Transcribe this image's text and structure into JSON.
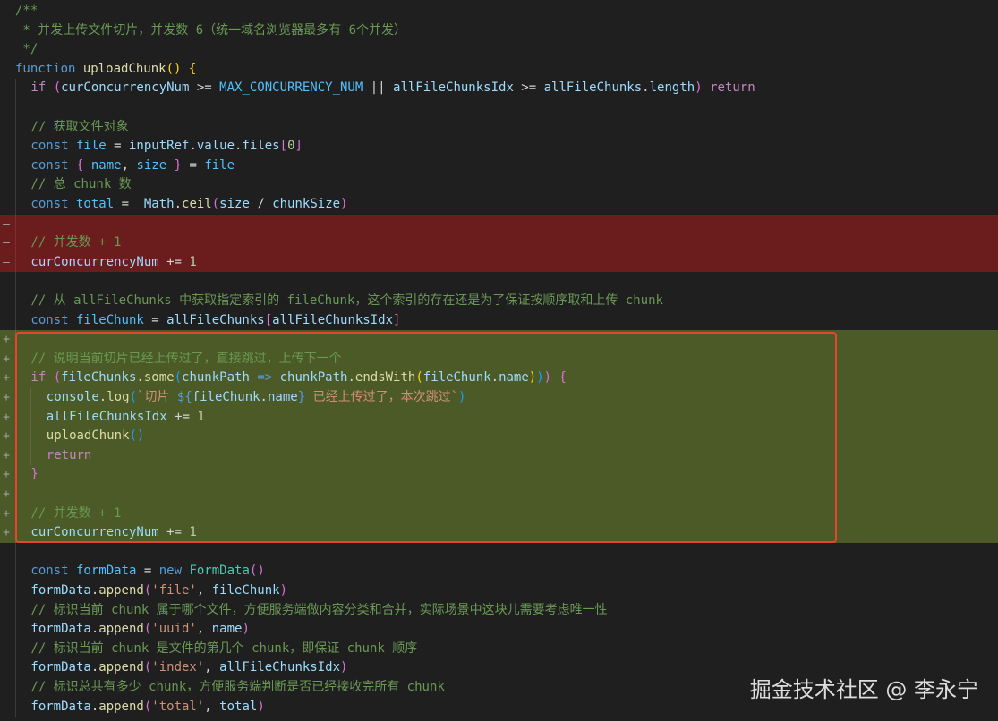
{
  "editor": {
    "language": "javascript",
    "lines": [
      {
        "diff": "",
        "indent": 0,
        "tokens": [
          {
            "t": "/**",
            "c": "cm"
          }
        ]
      },
      {
        "diff": "",
        "indent": 0,
        "tokens": [
          {
            "t": " * 并发上传文件切片，并发数 6（统一域名浏览器最多有 6个并发）",
            "c": "cm"
          }
        ]
      },
      {
        "diff": "",
        "indent": 0,
        "tokens": [
          {
            "t": " */",
            "c": "cm"
          }
        ]
      },
      {
        "diff": "",
        "indent": 0,
        "tokens": [
          {
            "t": "function",
            "c": "st"
          },
          {
            "t": " ",
            "c": "op"
          },
          {
            "t": "uploadChunk",
            "c": "fn"
          },
          {
            "t": "()",
            "c": "b1"
          },
          {
            "t": " ",
            "c": "op"
          },
          {
            "t": "{",
            "c": "b1"
          }
        ]
      },
      {
        "diff": "",
        "indent": 1,
        "tokens": [
          {
            "t": "if",
            "c": "kw"
          },
          {
            "t": " ",
            "c": "op"
          },
          {
            "t": "(",
            "c": "b2"
          },
          {
            "t": "curConcurrencyNum",
            "c": "vr"
          },
          {
            "t": " >= ",
            "c": "op"
          },
          {
            "t": "MAX_CONCURRENCY_NUM",
            "c": "cn"
          },
          {
            "t": " || ",
            "c": "op"
          },
          {
            "t": "allFileChunksIdx",
            "c": "vr"
          },
          {
            "t": " >= ",
            "c": "op"
          },
          {
            "t": "allFileChunks",
            "c": "vr"
          },
          {
            "t": ".",
            "c": "op"
          },
          {
            "t": "length",
            "c": "vr"
          },
          {
            "t": ")",
            "c": "b2"
          },
          {
            "t": " ",
            "c": "op"
          },
          {
            "t": "return",
            "c": "kw"
          }
        ]
      },
      {
        "diff": "",
        "indent": 1,
        "tokens": []
      },
      {
        "diff": "",
        "indent": 1,
        "tokens": [
          {
            "t": "// 获取文件对象",
            "c": "cm"
          }
        ]
      },
      {
        "diff": "",
        "indent": 1,
        "tokens": [
          {
            "t": "const",
            "c": "st"
          },
          {
            "t": " ",
            "c": "op"
          },
          {
            "t": "file",
            "c": "cn"
          },
          {
            "t": " = ",
            "c": "op"
          },
          {
            "t": "inputRef",
            "c": "vr"
          },
          {
            "t": ".",
            "c": "op"
          },
          {
            "t": "value",
            "c": "vr"
          },
          {
            "t": ".",
            "c": "op"
          },
          {
            "t": "files",
            "c": "vr"
          },
          {
            "t": "[",
            "c": "b2"
          },
          {
            "t": "0",
            "c": "nm"
          },
          {
            "t": "]",
            "c": "b2"
          }
        ]
      },
      {
        "diff": "",
        "indent": 1,
        "tokens": [
          {
            "t": "const",
            "c": "st"
          },
          {
            "t": " ",
            "c": "op"
          },
          {
            "t": "{",
            "c": "b2"
          },
          {
            "t": " ",
            "c": "op"
          },
          {
            "t": "name",
            "c": "cn"
          },
          {
            "t": ", ",
            "c": "op"
          },
          {
            "t": "size",
            "c": "cn"
          },
          {
            "t": " ",
            "c": "op"
          },
          {
            "t": "}",
            "c": "b2"
          },
          {
            "t": " = ",
            "c": "op"
          },
          {
            "t": "file",
            "c": "cn"
          }
        ]
      },
      {
        "diff": "",
        "indent": 1,
        "tokens": [
          {
            "t": "// 总 chunk 数",
            "c": "cm"
          }
        ]
      },
      {
        "diff": "",
        "indent": 1,
        "tokens": [
          {
            "t": "const",
            "c": "st"
          },
          {
            "t": " ",
            "c": "op"
          },
          {
            "t": "total",
            "c": "cn"
          },
          {
            "t": " =  ",
            "c": "op"
          },
          {
            "t": "Math",
            "c": "vr"
          },
          {
            "t": ".",
            "c": "op"
          },
          {
            "t": "ceil",
            "c": "fn"
          },
          {
            "t": "(",
            "c": "b2"
          },
          {
            "t": "size",
            "c": "vr"
          },
          {
            "t": " / ",
            "c": "op"
          },
          {
            "t": "chunkSize",
            "c": "vr"
          },
          {
            "t": ")",
            "c": "b2"
          }
        ]
      },
      {
        "diff": "-",
        "indent": 1,
        "tokens": []
      },
      {
        "diff": "-",
        "indent": 1,
        "tokens": [
          {
            "t": "// 并发数 + 1",
            "c": "cm"
          }
        ]
      },
      {
        "diff": "-",
        "indent": 1,
        "tokens": [
          {
            "t": "curConcurrencyNum",
            "c": "vr"
          },
          {
            "t": " += ",
            "c": "op"
          },
          {
            "t": "1",
            "c": "nm"
          }
        ]
      },
      {
        "diff": "",
        "indent": 1,
        "tokens": []
      },
      {
        "diff": "",
        "indent": 1,
        "tokens": [
          {
            "t": "// 从 allFileChunks 中获取指定索引的 fileChunk，这个索引的存在还是为了保证按顺序取和上传 chunk",
            "c": "cm"
          }
        ]
      },
      {
        "diff": "",
        "indent": 1,
        "tokens": [
          {
            "t": "const",
            "c": "st"
          },
          {
            "t": " ",
            "c": "op"
          },
          {
            "t": "fileChunk",
            "c": "cn"
          },
          {
            "t": " = ",
            "c": "op"
          },
          {
            "t": "allFileChunks",
            "c": "vr"
          },
          {
            "t": "[",
            "c": "b2"
          },
          {
            "t": "allFileChunksIdx",
            "c": "vr"
          },
          {
            "t": "]",
            "c": "b2"
          }
        ]
      },
      {
        "diff": "+",
        "indent": 1,
        "tokens": []
      },
      {
        "diff": "+",
        "indent": 1,
        "tokens": [
          {
            "t": "// 说明当前切片已经上传过了，直接跳过，上传下一个",
            "c": "cm"
          }
        ]
      },
      {
        "diff": "+",
        "indent": 1,
        "tokens": [
          {
            "t": "if",
            "c": "kw"
          },
          {
            "t": " ",
            "c": "op"
          },
          {
            "t": "(",
            "c": "b2"
          },
          {
            "t": "fileChunks",
            "c": "vr"
          },
          {
            "t": ".",
            "c": "op"
          },
          {
            "t": "some",
            "c": "fn"
          },
          {
            "t": "(",
            "c": "b3"
          },
          {
            "t": "chunkPath",
            "c": "vr"
          },
          {
            "t": " ",
            "c": "op"
          },
          {
            "t": "=>",
            "c": "st"
          },
          {
            "t": " ",
            "c": "op"
          },
          {
            "t": "chunkPath",
            "c": "vr"
          },
          {
            "t": ".",
            "c": "op"
          },
          {
            "t": "endsWith",
            "c": "fn"
          },
          {
            "t": "(",
            "c": "b1"
          },
          {
            "t": "fileChunk",
            "c": "vr"
          },
          {
            "t": ".",
            "c": "op"
          },
          {
            "t": "name",
            "c": "vr"
          },
          {
            "t": ")",
            "c": "b1"
          },
          {
            "t": ")",
            "c": "b3"
          },
          {
            "t": ")",
            "c": "b2"
          },
          {
            "t": " ",
            "c": "op"
          },
          {
            "t": "{",
            "c": "b2"
          }
        ]
      },
      {
        "diff": "+",
        "indent": 2,
        "tokens": [
          {
            "t": "console",
            "c": "vr"
          },
          {
            "t": ".",
            "c": "op"
          },
          {
            "t": "log",
            "c": "fn"
          },
          {
            "t": "(",
            "c": "b3"
          },
          {
            "t": "`切片 ",
            "c": "s"
          },
          {
            "t": "${",
            "c": "st"
          },
          {
            "t": "fileChunk",
            "c": "vr"
          },
          {
            "t": ".",
            "c": "op"
          },
          {
            "t": "name",
            "c": "vr"
          },
          {
            "t": "}",
            "c": "st"
          },
          {
            "t": " 已经上传过了，本次跳过`",
            "c": "s"
          },
          {
            "t": ")",
            "c": "b3"
          }
        ]
      },
      {
        "diff": "+",
        "indent": 2,
        "tokens": [
          {
            "t": "allFileChunksIdx",
            "c": "vr"
          },
          {
            "t": " += ",
            "c": "op"
          },
          {
            "t": "1",
            "c": "nm"
          }
        ]
      },
      {
        "diff": "+",
        "indent": 2,
        "tokens": [
          {
            "t": "uploadChunk",
            "c": "fn"
          },
          {
            "t": "()",
            "c": "b3"
          }
        ]
      },
      {
        "diff": "+",
        "indent": 2,
        "tokens": [
          {
            "t": "return",
            "c": "kw"
          }
        ]
      },
      {
        "diff": "+",
        "indent": 1,
        "tokens": [
          {
            "t": "}",
            "c": "b2"
          }
        ]
      },
      {
        "diff": "+",
        "indent": 1,
        "tokens": []
      },
      {
        "diff": "+",
        "indent": 1,
        "tokens": [
          {
            "t": "// 并发数 + 1",
            "c": "cm"
          }
        ]
      },
      {
        "diff": "+",
        "indent": 1,
        "tokens": [
          {
            "t": "curConcurrencyNum",
            "c": "vr"
          },
          {
            "t": " += ",
            "c": "op"
          },
          {
            "t": "1",
            "c": "nm"
          }
        ]
      },
      {
        "diff": "",
        "indent": 1,
        "tokens": []
      },
      {
        "diff": "",
        "indent": 1,
        "tokens": [
          {
            "t": "const",
            "c": "st"
          },
          {
            "t": " ",
            "c": "op"
          },
          {
            "t": "formData",
            "c": "cn"
          },
          {
            "t": " = ",
            "c": "op"
          },
          {
            "t": "new",
            "c": "st"
          },
          {
            "t": " ",
            "c": "op"
          },
          {
            "t": "FormData",
            "c": "cls"
          },
          {
            "t": "()",
            "c": "b2"
          }
        ]
      },
      {
        "diff": "",
        "indent": 1,
        "tokens": [
          {
            "t": "formData",
            "c": "vr"
          },
          {
            "t": ".",
            "c": "op"
          },
          {
            "t": "append",
            "c": "fn"
          },
          {
            "t": "(",
            "c": "b2"
          },
          {
            "t": "'file'",
            "c": "s"
          },
          {
            "t": ", ",
            "c": "op"
          },
          {
            "t": "fileChunk",
            "c": "vr"
          },
          {
            "t": ")",
            "c": "b2"
          }
        ]
      },
      {
        "diff": "",
        "indent": 1,
        "tokens": [
          {
            "t": "// 标识当前 chunk 属于哪个文件，方便服务端做内容分类和合并，实际场景中这块儿需要考虑唯一性",
            "c": "cm"
          }
        ]
      },
      {
        "diff": "",
        "indent": 1,
        "tokens": [
          {
            "t": "formData",
            "c": "vr"
          },
          {
            "t": ".",
            "c": "op"
          },
          {
            "t": "append",
            "c": "fn"
          },
          {
            "t": "(",
            "c": "b2"
          },
          {
            "t": "'uuid'",
            "c": "s"
          },
          {
            "t": ", ",
            "c": "op"
          },
          {
            "t": "name",
            "c": "vr"
          },
          {
            "t": ")",
            "c": "b2"
          }
        ]
      },
      {
        "diff": "",
        "indent": 1,
        "tokens": [
          {
            "t": "// 标识当前 chunk 是文件的第几个 chunk，即保证 chunk 顺序",
            "c": "cm"
          }
        ]
      },
      {
        "diff": "",
        "indent": 1,
        "tokens": [
          {
            "t": "formData",
            "c": "vr"
          },
          {
            "t": ".",
            "c": "op"
          },
          {
            "t": "append",
            "c": "fn"
          },
          {
            "t": "(",
            "c": "b2"
          },
          {
            "t": "'index'",
            "c": "s"
          },
          {
            "t": ", ",
            "c": "op"
          },
          {
            "t": "allFileChunksIdx",
            "c": "vr"
          },
          {
            "t": ")",
            "c": "b2"
          }
        ]
      },
      {
        "diff": "",
        "indent": 1,
        "tokens": [
          {
            "t": "// 标识总共有多少 chunk，方便服务端判断是否已经接收完所有 chunk",
            "c": "cm"
          }
        ]
      },
      {
        "diff": "",
        "indent": 1,
        "tokens": [
          {
            "t": "formData",
            "c": "vr"
          },
          {
            "t": ".",
            "c": "op"
          },
          {
            "t": "append",
            "c": "fn"
          },
          {
            "t": "(",
            "c": "b2"
          },
          {
            "t": "'total'",
            "c": "s"
          },
          {
            "t": ", ",
            "c": "op"
          },
          {
            "t": "total",
            "c": "vr"
          },
          {
            "t": ")",
            "c": "b2"
          }
        ]
      }
    ]
  },
  "watermark": {
    "text": "掘金技术社区 @ 李永宁"
  },
  "colors": {
    "background": "#1f1f1f",
    "removed_line_bg": "#6b1d1d",
    "added_line_bg": "#4b5a26",
    "highlight_box_border": "#e8452c",
    "comment": "#6a9955",
    "keyword": "#c586c0",
    "storage": "#569cd6",
    "function": "#dcdcaa",
    "variable": "#9cdcfe",
    "constant": "#4fc1ff",
    "number": "#b5cea8",
    "string": "#ce9178"
  }
}
